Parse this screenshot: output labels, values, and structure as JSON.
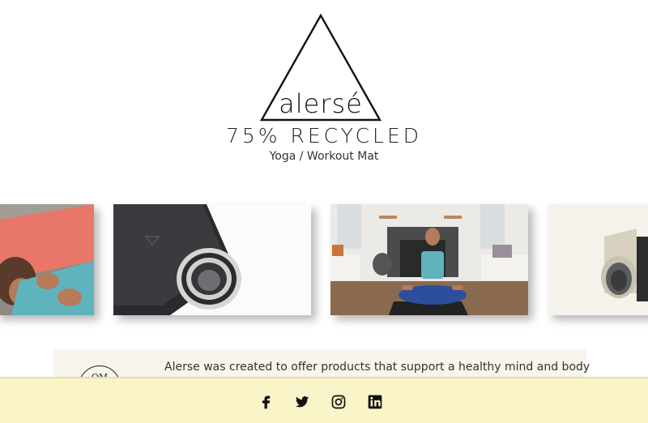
{
  "brand": {
    "wordmark": "alersé",
    "headline": "75% RECYCLED",
    "subhead": "Yoga / Workout Mat"
  },
  "carousel": {
    "slides": [
      {
        "name": "woman-lying-on-mat"
      },
      {
        "name": "rolled-mat-closeup"
      },
      {
        "name": "woman-meditating"
      },
      {
        "name": "rolled-mats-beige"
      }
    ]
  },
  "about": {
    "badge_text": "OM",
    "text": "Alerse was created to offer products that support a healthy mind and body"
  },
  "footer": {
    "social": [
      {
        "icon": "facebook-icon"
      },
      {
        "icon": "twitter-icon"
      },
      {
        "icon": "instagram-icon"
      },
      {
        "icon": "linkedin-icon"
      }
    ]
  },
  "colors": {
    "footer_bg": "#faf5c8",
    "about_bg": "#f7f5ec",
    "mat_coral": "#e8776a",
    "shirt_teal": "#5fb3bd"
  }
}
